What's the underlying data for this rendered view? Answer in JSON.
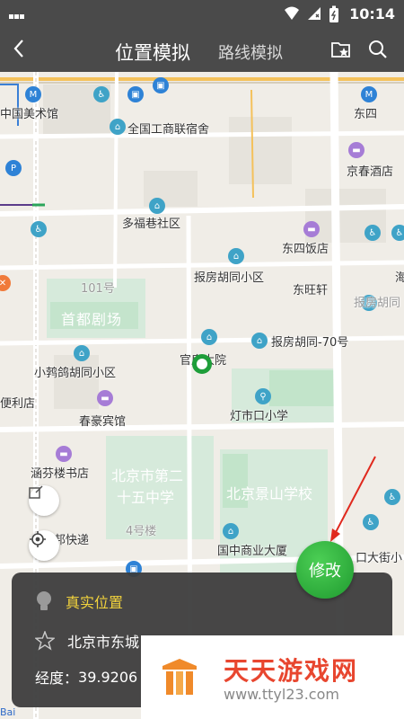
{
  "status": {
    "time": "10:14"
  },
  "navbar": {
    "title": "位置模拟",
    "tab2": "路线模拟"
  },
  "map": {
    "labels": {
      "meishuguan": "中国美术馆",
      "dongsi": "东四",
      "gongshang": "全国工商联宿舍",
      "jingchun": "京春酒店",
      "duofu": "多福巷社区",
      "dongsifandian": "东四饭店",
      "haojian": "101号",
      "baofang": "报房胡同小区",
      "dongwangxuan": "东旺轩",
      "baofanghutong": "报房胡同",
      "shoudu": "首都剧场",
      "baofang70": "报房胡同-70号",
      "guanshu": "官房大院",
      "xiaoque": "小鹁鸽胡同小区",
      "bianlidian": "便利店",
      "chunhao": "春豪宾馆",
      "dengshikou": "灯市口小学",
      "hanfen": "涵芬楼书店",
      "school25": "北京市第二十五中学",
      "school25a": "北京市第二",
      "school25b": "十五中学",
      "jingshan": "北京景山学校",
      "louhao": "4号楼",
      "kuaidi": "邦快递",
      "guozhong": "国中商业大厦",
      "dajie": "口大街小",
      "hai": "海"
    }
  },
  "panel": {
    "real_label": "真实位置",
    "address": "北京市东城",
    "lat_label": "经度：",
    "lat_value": "39.9206"
  },
  "modify_button": "修改",
  "watermark": {
    "title": "天天游戏网",
    "url": "www.ttyl23.com"
  },
  "baidu": "Bai"
}
